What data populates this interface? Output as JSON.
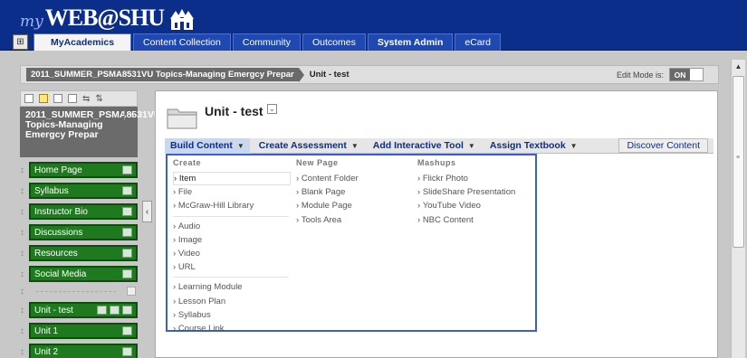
{
  "header": {
    "logo_my": "my",
    "logo_brand": "WEB@SHU",
    "tabs": [
      "MyAcademics",
      "Content Collection",
      "Community",
      "Outcomes",
      "System Admin",
      "eCard"
    ]
  },
  "coursebar": {
    "course": "2011_SUMMER_PSMA8531VU Topics-Managing Emergcy Prepar",
    "page": "Unit - test",
    "edit_mode_label": "Edit Mode is:",
    "edit_mode_value": "ON"
  },
  "leftmenu": {
    "course_title": "2011_SUMMER_PSMA8531VU Topics-Managing Emergcy Prepar",
    "items": [
      "Home Page",
      "Syllabus",
      "Instructor Bio",
      "Discussions",
      "Resources",
      "Social Media",
      "Unit - test",
      "Unit 1",
      "Unit 2"
    ]
  },
  "content": {
    "title": "Unit - test",
    "actions": [
      "Build Content",
      "Create Assessment",
      "Add Interactive Tool",
      "Assign Textbook"
    ],
    "discover": "Discover Content",
    "dropdown": {
      "create": {
        "heading": "Create",
        "group1": [
          "Item",
          "File",
          "McGraw-Hill Library"
        ],
        "group2": [
          "Audio",
          "Image",
          "Video",
          "URL"
        ],
        "group3": [
          "Learning Module",
          "Lesson Plan",
          "Syllabus",
          "Course Link"
        ]
      },
      "newpage": {
        "heading": "New Page",
        "items": [
          "Content Folder",
          "Blank Page",
          "Module Page",
          "Tools Area"
        ]
      },
      "mashups": {
        "heading": "Mashups",
        "items": [
          "Flickr Photo",
          "SlideShare Presentation",
          "YouTube Video",
          "NBC Content"
        ]
      }
    }
  }
}
